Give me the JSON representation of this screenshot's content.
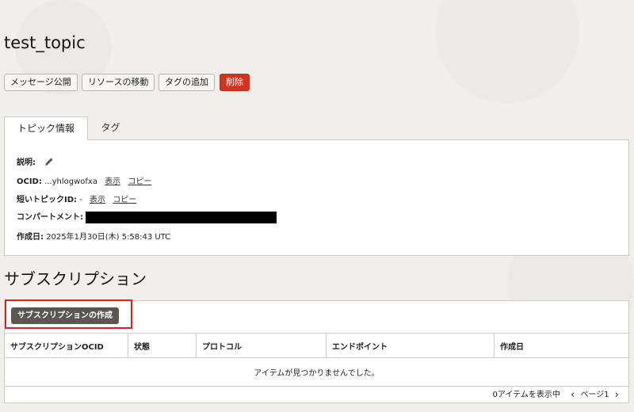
{
  "page": {
    "title": "test_topic"
  },
  "actions": {
    "publish": "メッセージ公開",
    "move": "リソースの移動",
    "add_tags": "タグの追加",
    "delete": "削除",
    "danger_color": "#d1341f"
  },
  "tabs": [
    {
      "label": "トピック情報",
      "active": true
    },
    {
      "label": "タグ",
      "active": false
    }
  ],
  "info": {
    "description_label": "説明:",
    "ocid_label": "OCID:",
    "ocid_value": "...yhlogwofxa",
    "show_link": "表示",
    "copy_link": "コピー",
    "short_id_label": "短いトピックID:",
    "short_id_value": "-",
    "compartment_label": "コンパートメント:",
    "created_label": "作成日:",
    "created_value": "2025年1月30日(木) 5:58:43 UTC"
  },
  "subscriptions": {
    "heading": "サブスクリプション",
    "create_button": "サブスクリプションの作成",
    "columns": [
      "サブスクリプションOCID",
      "状態",
      "プロトコル",
      "エンドポイント",
      "作成日"
    ],
    "empty_message": "アイテムが見つかりませんでした。",
    "displaying": "0アイテムを表示中",
    "page_label": "ページ1",
    "highlight_color": "#e02020"
  }
}
